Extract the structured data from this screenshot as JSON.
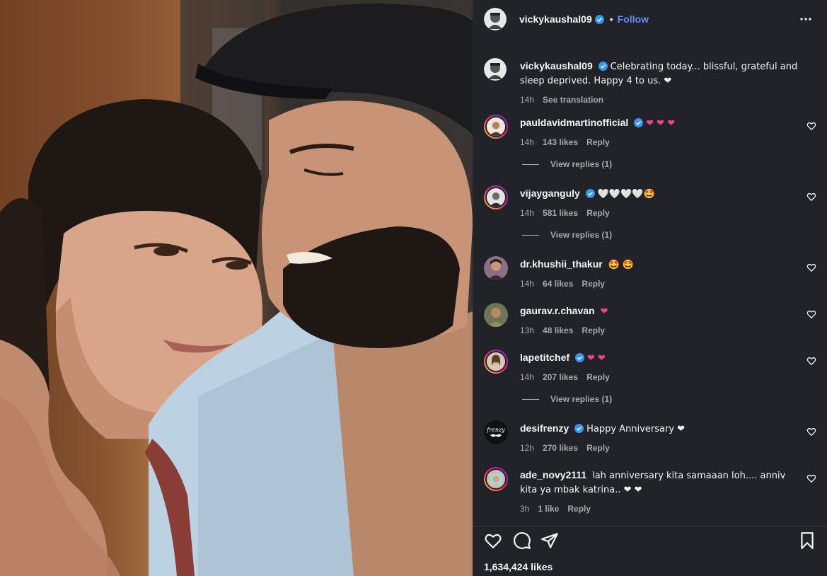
{
  "post": {
    "author": "vickykaushal09",
    "follow_label": "Follow",
    "dot": "•",
    "caption": "Celebrating today... blissful, grateful and sleep deprived. Happy 4 to us. ❤",
    "caption_time": "14h",
    "see_translation": "See translation",
    "likes_total": "1,634,424 likes"
  },
  "comments": [
    {
      "user": "pauldavidmartinofficial",
      "verified": true,
      "text": "❤ ❤ ❤",
      "time": "14h",
      "likes": "143 likes",
      "reply": "Reply",
      "view_replies": "View replies (1)"
    },
    {
      "user": "vijayganguly",
      "verified": true,
      "text": "🤍🤍🤍🤍🤩",
      "time": "14h",
      "likes": "581 likes",
      "reply": "Reply",
      "view_replies": "View replies (1)"
    },
    {
      "user": "dr.khushii_thakur",
      "verified": false,
      "text": "🤩 🤩",
      "time": "14h",
      "likes": "64 likes",
      "reply": "Reply"
    },
    {
      "user": "gaurav.r.chavan",
      "verified": false,
      "text": "❤",
      "time": "13h",
      "likes": "48 likes",
      "reply": "Reply"
    },
    {
      "user": "lapetitchef",
      "verified": true,
      "text": "❤ ❤",
      "time": "14h",
      "likes": "207 likes",
      "reply": "Reply",
      "view_replies": "View replies (1)"
    },
    {
      "user": "desifrenzy",
      "verified": true,
      "text": "Happy Anniversary ❤",
      "time": "12h",
      "likes": "270 likes",
      "reply": "Reply"
    },
    {
      "user": "ade_novy2111",
      "verified": false,
      "text": "lah anniversary kita samaaan loh.... anniv kita ya mbak katrina.. ❤ ❤",
      "time": "3h",
      "likes": "1 like",
      "reply": "Reply"
    }
  ],
  "desifrenzy_logo_text": "frenzy",
  "icons": {
    "like": "heart-outline-icon",
    "comment": "comment-bubble-icon",
    "share": "paper-plane-icon",
    "save": "bookmark-icon",
    "more": "more-dots-icon",
    "verified": "verified-badge-icon"
  },
  "colors": {
    "panel_bg": "#212328",
    "follow": "#6b8cff",
    "verified": "#3797f0",
    "heart": "#f0458a",
    "meta": "#a8a8a8"
  }
}
